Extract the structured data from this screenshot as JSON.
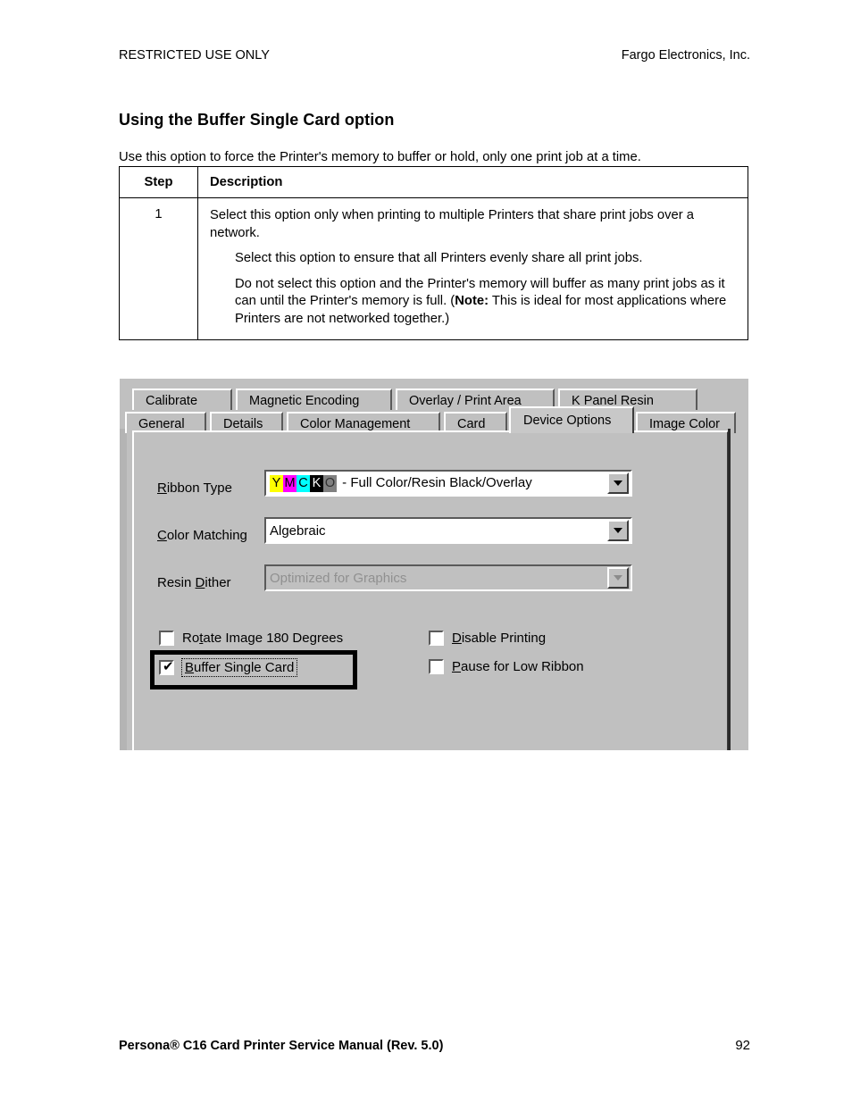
{
  "page": {
    "header_left": "RESTRICTED USE ONLY",
    "header_right": "Fargo Electronics, Inc.",
    "title": "Using the Buffer Single Card option",
    "intro": "Use this option to force the Printer's memory to buffer or hold, only one print job at a time.",
    "footer_left": "Persona® C16 Card Printer Service Manual (Rev. 5.0)",
    "footer_page": "92"
  },
  "table": {
    "headers": {
      "step": "Step",
      "description": "Description"
    },
    "rows": [
      {
        "step": "1",
        "paragraphs": [
          {
            "indent": false,
            "text": "Select this option only when printing to multiple Printers that share print jobs over a network."
          },
          {
            "indent": true,
            "text": "Select this option to ensure that all Printers evenly share all print jobs."
          },
          {
            "indent": true,
            "text_before_bold": "Do not select this option and the Printer's memory will buffer as many print jobs as it can until the Printer's memory is full. (",
            "bold": "Note:",
            "text_after_bold": "  This is ideal for most applications where Printers are not networked together.)"
          }
        ]
      }
    ]
  },
  "dialog": {
    "tabs_top": [
      {
        "label": "Calibrate",
        "selected": false
      },
      {
        "label": "Magnetic Encoding",
        "selected": false
      },
      {
        "label": "Overlay / Print Area",
        "selected": false
      },
      {
        "label": "K Panel Resin",
        "selected": false
      }
    ],
    "tabs_bottom": [
      {
        "label": "General",
        "selected": false
      },
      {
        "label": "Details",
        "selected": false
      },
      {
        "label": "Color Management",
        "selected": false
      },
      {
        "label": "Card",
        "selected": false
      },
      {
        "label": "Device Options",
        "selected": true
      },
      {
        "label": "Image Color",
        "selected": false
      }
    ],
    "fields": {
      "ribbon_type": {
        "label_accel": "R",
        "label_rest": "ibbon Type",
        "swatches": [
          {
            "letter": "Y",
            "bg": "#ffff00",
            "fg": "#000000"
          },
          {
            "letter": "M",
            "bg": "#ff00ff",
            "fg": "#000000"
          },
          {
            "letter": "C",
            "bg": "#00ffff",
            "fg": "#000000"
          },
          {
            "letter": "K",
            "bg": "#000000",
            "fg": "#ffffff"
          },
          {
            "letter": "O",
            "bg": "#808080",
            "fg": "#303030"
          }
        ],
        "value_suffix": " - Full Color/Resin Black/Overlay",
        "enabled": true
      },
      "color_matching": {
        "label_accel": "C",
        "label_rest": "olor Matching",
        "value": "Algebraic",
        "enabled": true
      },
      "resin_dither": {
        "label_pre": "Resin ",
        "label_accel": "D",
        "label_rest": "ither",
        "value": "Optimized for Graphics",
        "enabled": false
      }
    },
    "checkboxes": [
      {
        "name": "rotate-image",
        "accel_pre": "Ro",
        "accel": "t",
        "accel_post": "ate Image 180 Degrees",
        "checked": false,
        "focused": false
      },
      {
        "name": "buffer-single-card",
        "accel_pre": "",
        "accel": "B",
        "accel_post": "uffer Single Card",
        "checked": true,
        "focused": true
      },
      {
        "name": "disable-printing",
        "accel_pre": "",
        "accel": "D",
        "accel_post": "isable Printing",
        "checked": false,
        "focused": false
      },
      {
        "name": "pause-for-low-ribbon",
        "accel_pre": "",
        "accel": "P",
        "accel_post": "ause for Low Ribbon",
        "checked": false,
        "focused": false
      }
    ],
    "checkmark_glyph": "✔"
  }
}
